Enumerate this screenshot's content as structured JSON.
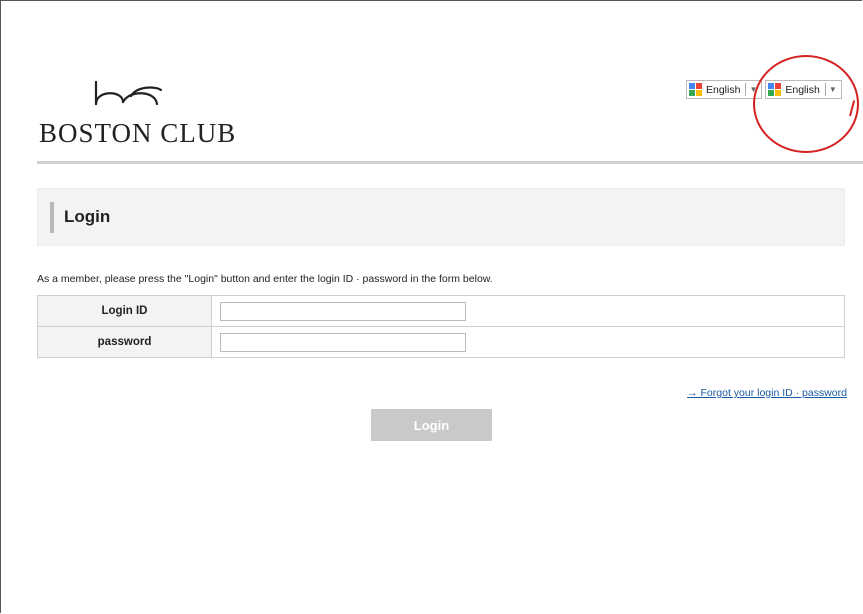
{
  "brand": {
    "logo_mark": "bc",
    "name": "BOSTON CLUB"
  },
  "translate_widgets": [
    {
      "label": "English",
      "icon": "google-translate-icon",
      "caret": "▼"
    },
    {
      "label": "English",
      "icon": "google-translate-icon",
      "caret": "▼"
    }
  ],
  "page": {
    "title": "Login"
  },
  "instructions": "As a member, please press the \"Login\" button and enter the login ID · password in the form below.",
  "form": {
    "login_id_label": "Login ID",
    "login_id_value": "",
    "password_label": "password",
    "password_value": ""
  },
  "forgot_link": "→ Forgot your login ID · password",
  "login_button": "Login",
  "colors": {
    "highlight": "#d42222",
    "button_disabled": "#c9c9c9",
    "link": "#1a5aa6",
    "panel": "#f3f3f3"
  }
}
